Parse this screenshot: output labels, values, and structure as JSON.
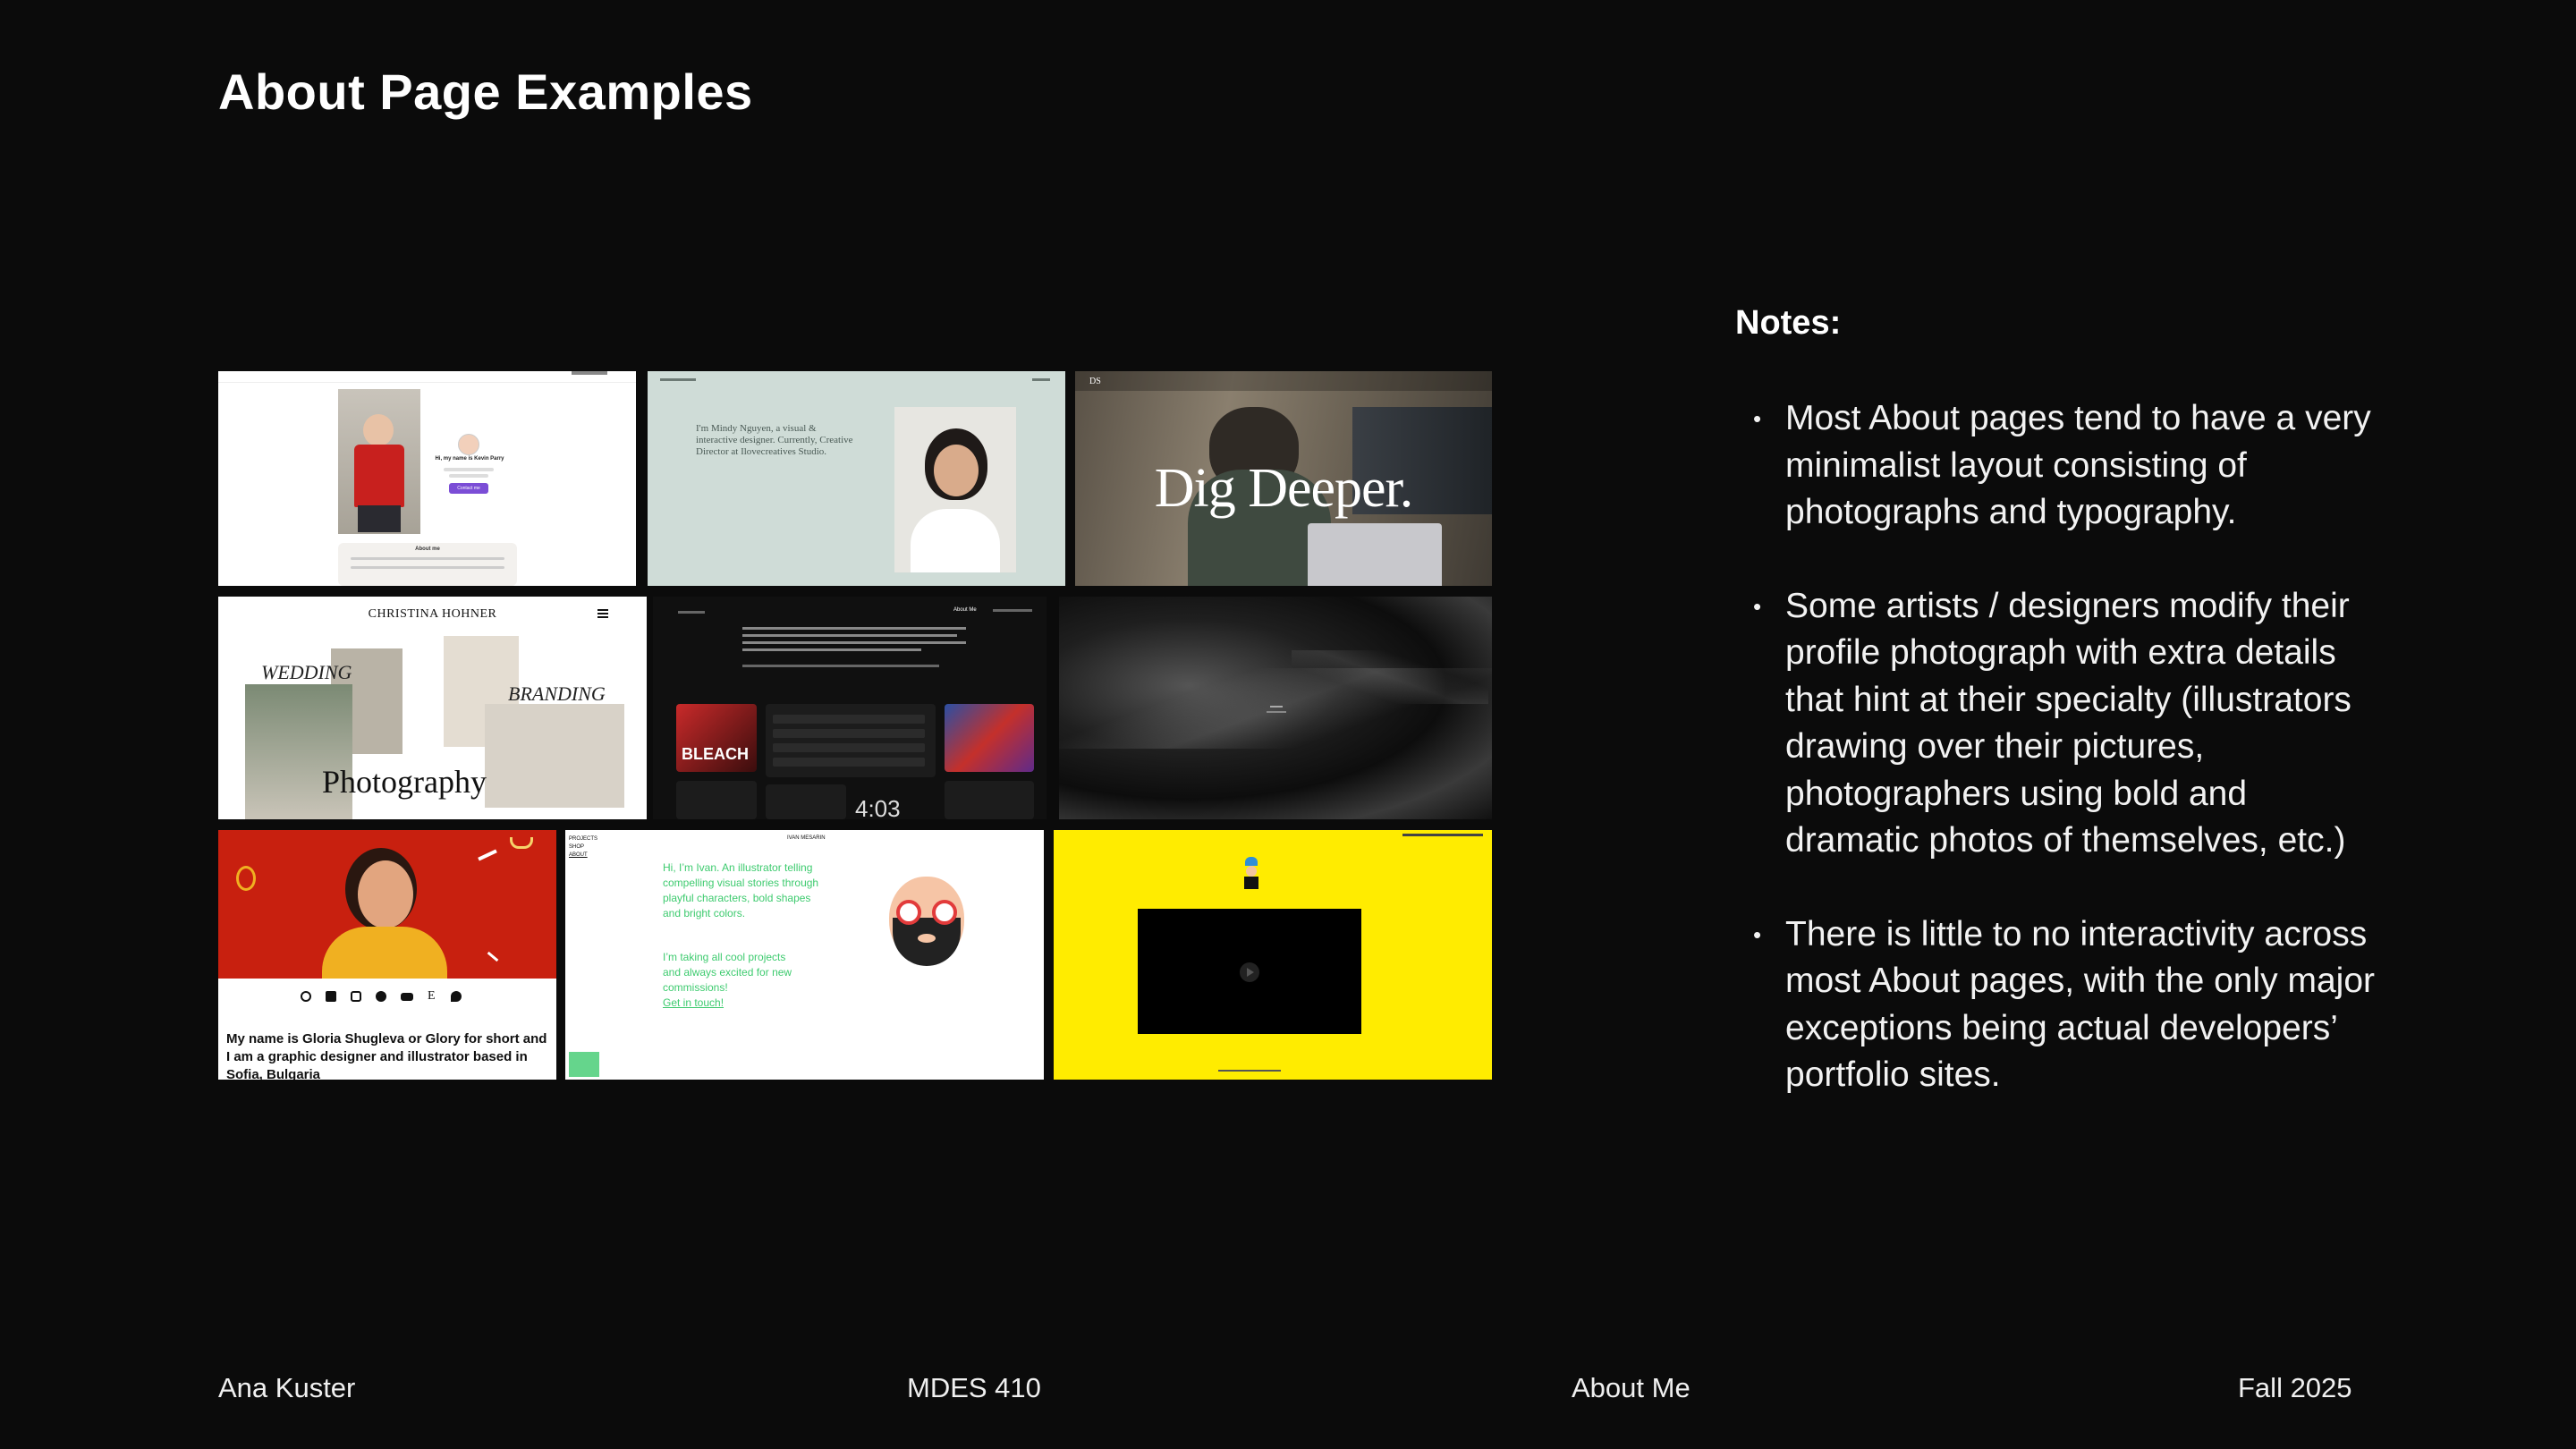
{
  "slide": {
    "title": "About Page Examples"
  },
  "notes": {
    "heading": "Notes:",
    "items": [
      "Most About pages tend to have a very minimalist layout consisting of photographs and typography.",
      "Some artists / designers modify their profile photograph with extra details that hint at their specialty (illustrators drawing over their pictures, photographers using bold and dramatic photos of themselves, etc.)",
      "There is little to no interactivity across most About pages, with the only major exceptions being actual developers’ portfolio sites."
    ]
  },
  "thumbnails": {
    "t1": {
      "greeting": "Hi, my name is Kevin Parry",
      "button": "Contact me",
      "about": "About me"
    },
    "t2": {
      "text": "I'm Mindy Nguyen, a visual & interactive designer. Currently, Creative Director at Ilovecreatives Studio."
    },
    "t3": {
      "logo": "DS",
      "headline": "Dig Deeper."
    },
    "t4": {
      "name": "CHRISTINA HOHNER",
      "w1": "WEDDING",
      "w2": "BRANDING",
      "w3": "Photography"
    },
    "t5": {
      "nav": "About Me",
      "tile": "BLEACH",
      "clock": "4:03"
    },
    "t7": {
      "bio": "My name is Gloria Shugleva or Glory for short and I am a graphic designer and illustrator based in Sofia, Bulgaria"
    },
    "t8": {
      "nav": [
        "PROJECTS",
        "SHOP",
        "ABOUT"
      ],
      "header": "IVAN MESARIN",
      "intro": "Hi, I’m Ivan. An illustrator telling compelling visual stories through playful characters, bold shapes and bright colors.",
      "cta": "I’m taking all cool projects and always excited for new commissions!",
      "link": "Get in touch!"
    }
  },
  "footer": {
    "author": "Ana Kuster",
    "course": "MDES 410",
    "topic": "About Me",
    "term": "Fall 2025"
  },
  "colors": {
    "background": "#0b0b0b",
    "text": "#ffffff",
    "sage": "#cfdcd7",
    "red": "#c8200f",
    "yellow": "#ffec00",
    "green": "#3ecb6f"
  }
}
